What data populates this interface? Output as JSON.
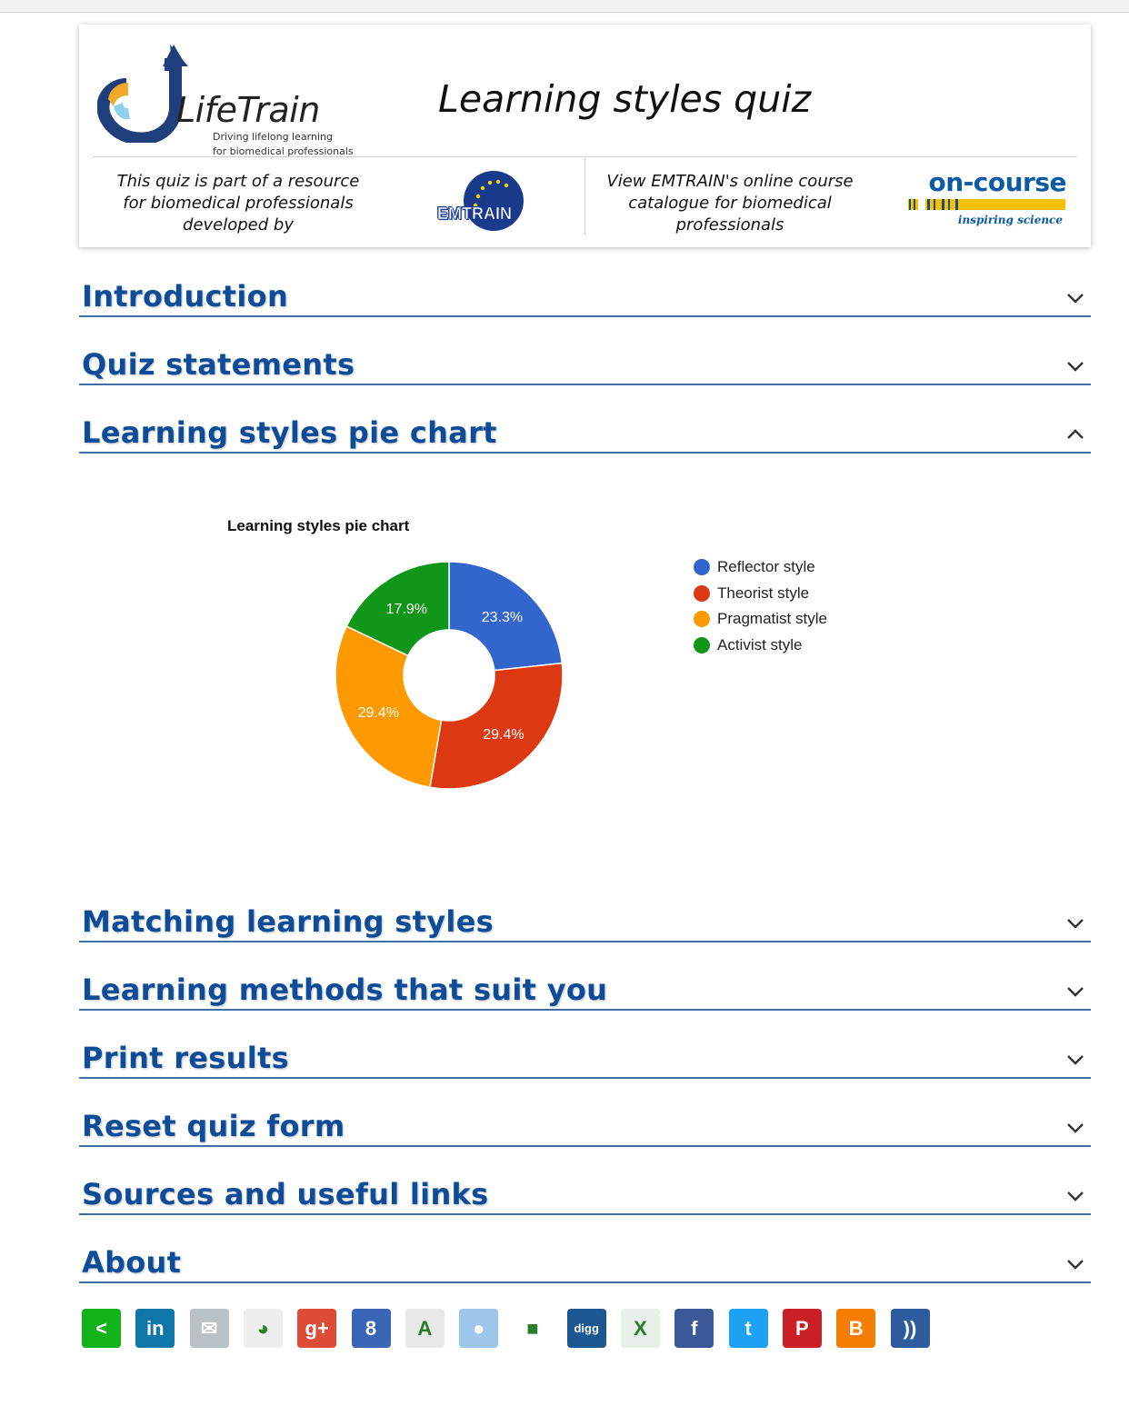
{
  "header": {
    "logo_name": "LifeTrain",
    "logo_tagline_1": "Driving lifelong learning",
    "logo_tagline_2": "for biomedical professionals",
    "title": "Learning styles quiz",
    "left_text": "This quiz is part of a resource for biomedical professionals developed by",
    "emtrain_label": "EMTRAIN",
    "right_text": "View EMTRAIN's online course catalogue for biomedical professionals",
    "oncourse_label": "on-course",
    "oncourse_tagline": "inspiring science"
  },
  "sections": [
    {
      "title": "Introduction",
      "expanded": false
    },
    {
      "title": "Quiz statements",
      "expanded": false
    },
    {
      "title": "Learning styles pie chart",
      "expanded": true
    },
    {
      "title": "Matching learning styles",
      "expanded": false
    },
    {
      "title": "Learning methods that suit you",
      "expanded": false
    },
    {
      "title": "Print results",
      "expanded": false
    },
    {
      "title": "Reset quiz form",
      "expanded": false
    },
    {
      "title": "Sources and useful links",
      "expanded": false
    },
    {
      "title": "About",
      "expanded": false
    }
  ],
  "chart_data": {
    "type": "pie",
    "donut": true,
    "title": "Learning styles pie chart",
    "categories": [
      "Reflector style",
      "Theorist style",
      "Pragmatist style",
      "Activist style"
    ],
    "values": [
      23.3,
      29.4,
      29.4,
      17.9
    ],
    "labels": [
      "23.3%",
      "29.4%",
      "29.4%",
      "17.9%"
    ],
    "colors": [
      "#3366cc",
      "#dc3912",
      "#ff9900",
      "#109618"
    ],
    "legend_position": "right"
  },
  "share_icons": [
    {
      "name": "share",
      "glyph": "<",
      "color": "#12b21a"
    },
    {
      "name": "linkedin",
      "glyph": "in",
      "color": "#0e76a8"
    },
    {
      "name": "email",
      "glyph": "✉",
      "color": "#b9c0c6"
    },
    {
      "name": "google-bookmarks",
      "glyph": "◕",
      "color": "#eeeeee"
    },
    {
      "name": "google-plus",
      "glyph": "g+",
      "color": "#dd4b39"
    },
    {
      "name": "google",
      "glyph": "8",
      "color": "#3b66b8"
    },
    {
      "name": "google-translate",
      "glyph": "A",
      "color": "#e8e8e8"
    },
    {
      "name": "reddit",
      "glyph": "●",
      "color": "#9cc7ea"
    },
    {
      "name": "delicious",
      "glyph": "■",
      "color": "#ffffff"
    },
    {
      "name": "digg",
      "glyph": "digg",
      "color": "#1b5891"
    },
    {
      "name": "xing",
      "glyph": "X",
      "color": "#e9efe9"
    },
    {
      "name": "facebook",
      "glyph": "f",
      "color": "#3b5998"
    },
    {
      "name": "twitter",
      "glyph": "t",
      "color": "#1da1f2"
    },
    {
      "name": "pinterest",
      "glyph": "P",
      "color": "#cb2027"
    },
    {
      "name": "blogger",
      "glyph": "B",
      "color": "#f57d00"
    },
    {
      "name": "rss",
      "glyph": "))",
      "color": "#2d5c9e"
    }
  ]
}
